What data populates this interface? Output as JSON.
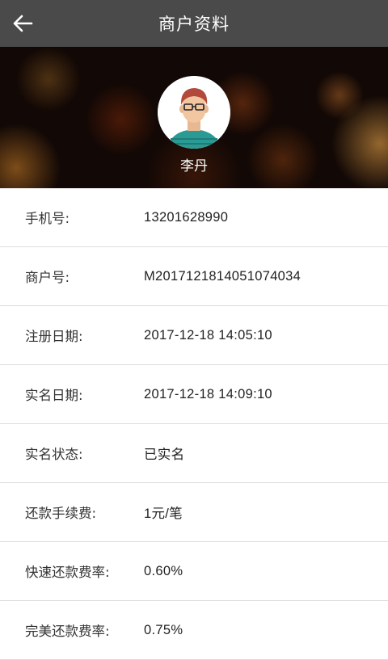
{
  "header": {
    "title": "商户资料",
    "back_icon": "arrow-left-icon"
  },
  "profile": {
    "name": "李丹",
    "avatar_icon": "user-avatar-icon"
  },
  "info_rows": [
    {
      "label": "手机号:",
      "value": "13201628990"
    },
    {
      "label": "商户号:",
      "value": "M2017121814051074034"
    },
    {
      "label": "注册日期:",
      "value": "2017-12-18 14:05:10"
    },
    {
      "label": "实名日期:",
      "value": "2017-12-18 14:09:10"
    },
    {
      "label": "实名状态:",
      "value": "已实名"
    },
    {
      "label": "还款手续费:",
      "value": "1元/笔"
    },
    {
      "label": "快速还款费率:",
      "value": "0.60%"
    },
    {
      "label": "完美还款费率:",
      "value": "0.75%"
    }
  ],
  "colors": {
    "header_bg": "#4a4a4a",
    "text": "#333333",
    "divider": "#dcdcdc"
  }
}
